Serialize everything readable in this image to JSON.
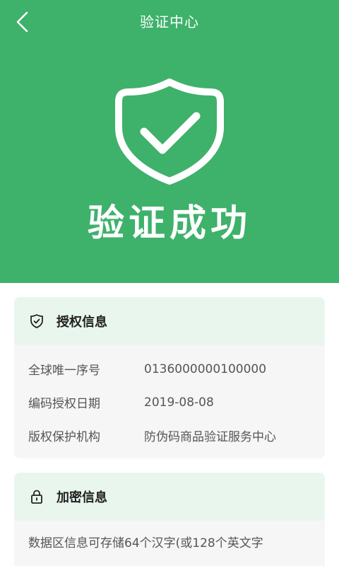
{
  "header": {
    "title": "验证中心",
    "back_icon": "chevron-left-icon"
  },
  "hero": {
    "status_text": "验证成功",
    "icon": "shield-check-icon",
    "color": "#3eb16b"
  },
  "auth_card": {
    "title": "授权信息",
    "icon": "shield-check-icon",
    "rows": [
      {
        "label": "全球唯一序号",
        "value": "0136000000100000"
      },
      {
        "label": "编码授权日期",
        "value": "2019-08-08"
      },
      {
        "label": "版权保护机构",
        "value": "防伪码商品验证服务中心"
      }
    ]
  },
  "encrypt_card": {
    "title": "加密信息",
    "icon": "lock-icon",
    "text": "数据区信息可存储64个汉字(或128个英文字"
  },
  "colors": {
    "accent": "#3eb16b",
    "card_header_bg": "#e9f6ee",
    "card_bg": "#f6f6f6"
  }
}
